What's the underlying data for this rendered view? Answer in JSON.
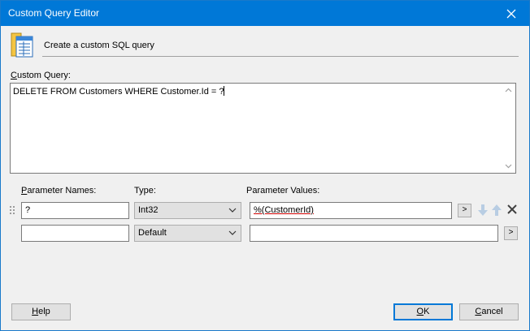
{
  "window": {
    "title": "Custom Query Editor"
  },
  "header": {
    "text": "Create a custom SQL query"
  },
  "query": {
    "label": "Custom Query:",
    "value": "DELETE FROM Customers WHERE Customer.Id = ?"
  },
  "params": {
    "col_names": "Parameter Names:",
    "col_type": "Type:",
    "col_values": "Parameter Values:",
    "rows": [
      {
        "name": "?",
        "type": "Int32",
        "value": "%(CustomerId)"
      },
      {
        "name": "",
        "type": "Default",
        "value": ""
      }
    ],
    "browse_label": ">"
  },
  "buttons": {
    "help": "Help",
    "ok": "OK",
    "cancel": "Cancel"
  },
  "colors": {
    "titlebar": "#0078d7",
    "accent": "#0078d7",
    "error_underline": "#d00000"
  },
  "icons": {
    "close": "close-icon",
    "header": "database-document-icon",
    "up": "arrow-up-icon",
    "down": "arrow-down-icon",
    "delete": "delete-x-icon"
  }
}
